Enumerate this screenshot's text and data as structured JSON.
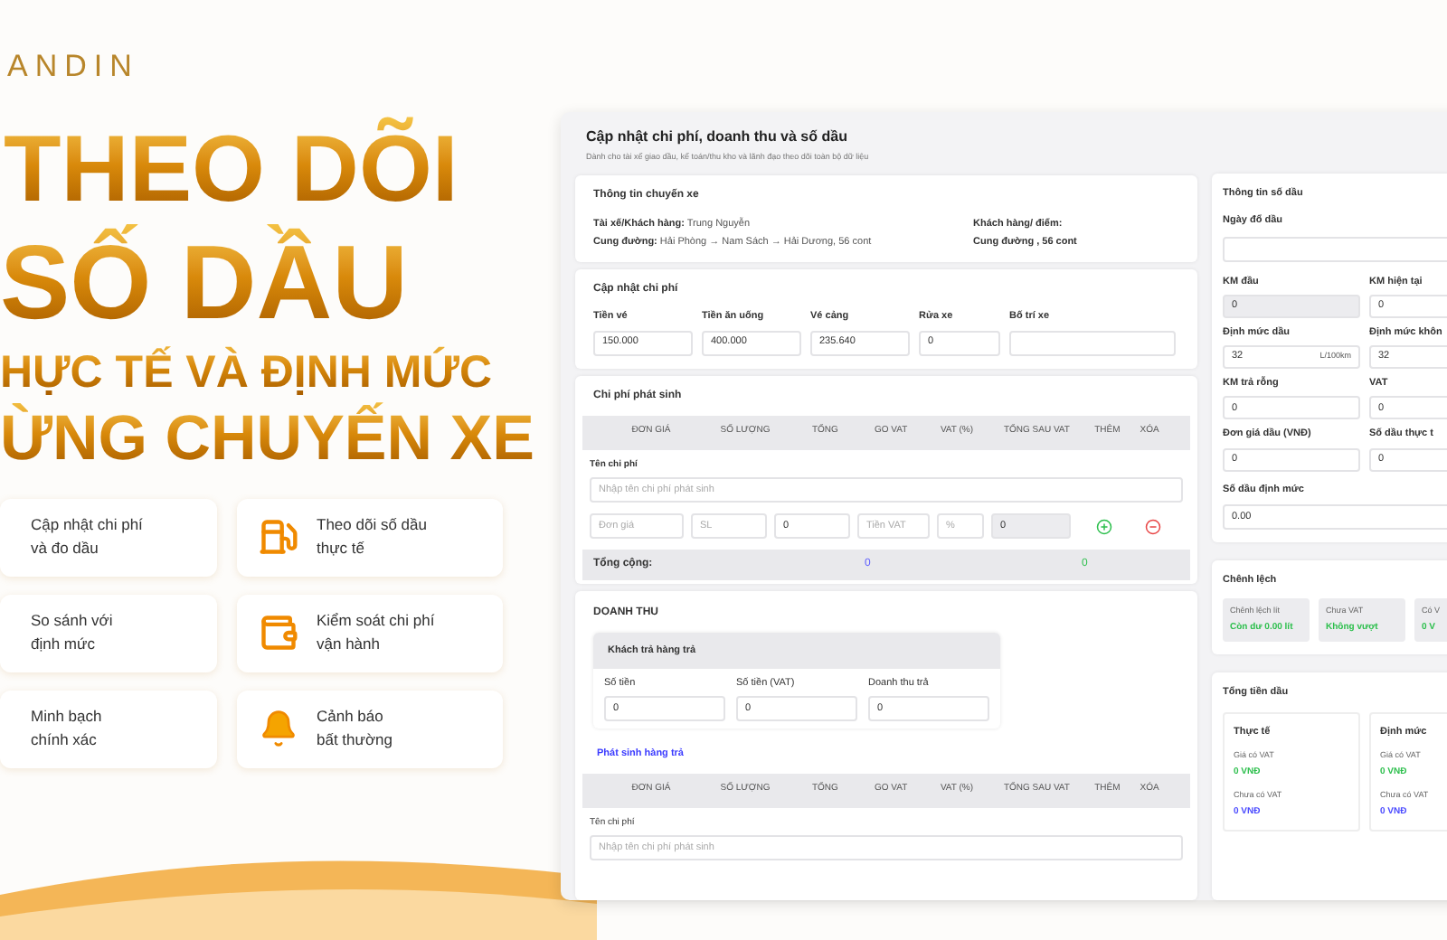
{
  "brand": {
    "logo": "ANDIN"
  },
  "headline": [
    "THEO DÕI",
    "SỐ DẦU",
    "HỰC TẾ VÀ ĐỊNH MỨC",
    "ỪNG CHUYẾN XE"
  ],
  "features": [
    {
      "lines": [
        "Cập nhật chi phí",
        "và đo dầu"
      ],
      "kind": "plain"
    },
    {
      "lines": [
        "Theo dõi số dầu",
        "thực tế"
      ],
      "kind": "fuel"
    },
    {
      "lines": [
        "So sánh với",
        "định mức"
      ],
      "kind": "plain"
    },
    {
      "lines": [
        "Kiểm soát chi phí",
        "vận hành"
      ],
      "kind": "wallet"
    },
    {
      "lines": [
        "Minh bạch",
        "chính xác"
      ],
      "kind": "plain"
    },
    {
      "lines": [
        "Cảnh báo",
        "bất thường"
      ],
      "kind": "bell"
    }
  ],
  "app": {
    "title": "Cập nhật chi phí, doanh thu và số dầu",
    "subtitle": "Dành cho tài xế giao dầu, kế toán/thu kho và lãnh đạo theo dõi toàn bộ dữ liệu",
    "trip": {
      "title": "Thông tin chuyến xe",
      "left": [
        {
          "label": "Tài xế/Khách hàng:",
          "value": "Trung Nguyễn"
        },
        {
          "label": "Cung đường:",
          "value": "Hải Phòng → Nam Sách → Hải Dương, 56 cont"
        }
      ],
      "right": [
        {
          "label": "Khách hàng/ điểm:"
        },
        {
          "label": "Cung đường , 56 cont"
        }
      ]
    },
    "costs": {
      "title": "Cập nhật chi phí",
      "fields": [
        {
          "label": "Tiền vé",
          "value": "150.000"
        },
        {
          "label": "Tiền ăn uống",
          "value": "400.000"
        },
        {
          "label": "Vé cảng",
          "value": "235.640"
        },
        {
          "label": "Rửa xe",
          "value": "0"
        },
        {
          "label": "Bố trí xe"
        }
      ]
    },
    "extra": {
      "title": "Chi phí phát sinh",
      "columns": [
        "ĐƠN GIÁ",
        "SỐ LƯỢNG",
        "TỔNG",
        "GO VAT",
        "VAT (%)",
        "TỔNG SAU VAT",
        "THÊM",
        "XÓA"
      ],
      "name_label": "Tên chi phí",
      "name_placeholder": "Nhập tên chi phí phát sinh",
      "inputs": [
        {
          "placeholder": "Đơn giá",
          "disabled": false
        },
        {
          "placeholder": "SL",
          "disabled": false
        },
        {
          "value": "0",
          "disabled": false
        },
        {
          "placeholder": "Tiền VAT",
          "disabled": false
        },
        {
          "placeholder": "%",
          "disabled": false
        },
        {
          "value": "0",
          "disabled": true
        }
      ],
      "total_label": "Tổng cộng:",
      "total": "0",
      "total_after_vat": "0"
    },
    "revenue": {
      "title": "DOANH THU",
      "customer": {
        "title": "Khách trả hàng trả",
        "fields": [
          {
            "label": "Số tiền",
            "value": "0"
          },
          {
            "label": "Số tiền (VAT)",
            "value": "0"
          },
          {
            "label": "Doanh thu trả",
            "value": "0"
          }
        ]
      },
      "returns": {
        "title": "Phát sinh hàng trả",
        "columns": [
          "ĐƠN GIÁ",
          "SỐ LƯỢNG",
          "TỔNG",
          "GO VAT",
          "VAT (%)",
          "TỔNG SAU VAT",
          "THÊM",
          "XÓA"
        ],
        "name_label": "Tên chi phí",
        "name_placeholder": "Nhập tên chi phí phát sinh"
      }
    }
  },
  "fuel": {
    "title": "Thông tin số dầu",
    "date_label": "Ngày đổ dầu",
    "fields": [
      {
        "label": "KM đầu",
        "value": "0",
        "disabled": true
      },
      {
        "label": "KM hiện tại",
        "value": "0",
        "disabled": false
      },
      {
        "label": "Định mức dầu",
        "value": "32",
        "unit": "L/100km",
        "disabled": false
      },
      {
        "label": "Định mức khôn",
        "value": "32",
        "disabled": false
      },
      {
        "label": "KM trả rỗng",
        "value": "0",
        "disabled": false
      },
      {
        "label": "VAT",
        "value": "0",
        "disabled": false
      },
      {
        "label": "Đơn giá dầu (VNĐ)",
        "value": "0",
        "disabled": false
      },
      {
        "label": "Số dầu thực t",
        "value": "0",
        "disabled": false
      }
    ],
    "norm": {
      "label": "Số dầu định mức",
      "value": "0.00"
    }
  },
  "difference": {
    "title": "Chênh lệch",
    "cards": [
      {
        "label": "Chênh lệch lít",
        "value": "Còn dư 0.00 lít"
      },
      {
        "label": "Chưa VAT",
        "value": "Không vượt"
      },
      {
        "label": "Có V",
        "value": "0 V"
      }
    ]
  },
  "total": {
    "title": "Tổng tiền dầu",
    "cards": [
      {
        "title": "Thực tế",
        "rows": [
          {
            "label": "Giá có VAT",
            "value": "0 VNĐ",
            "kind": "with_vat"
          },
          {
            "label": "Chưa có VAT",
            "value": "0 VNĐ",
            "kind": "without_vat"
          }
        ]
      },
      {
        "title": "Định mức",
        "rows": [
          {
            "label": "Giá có VAT",
            "value": "0 VNĐ",
            "kind": "with_vat"
          },
          {
            "label": "Chưa có VAT",
            "value": "0 VNĐ",
            "kind": "without_vat"
          }
        ]
      }
    ]
  }
}
